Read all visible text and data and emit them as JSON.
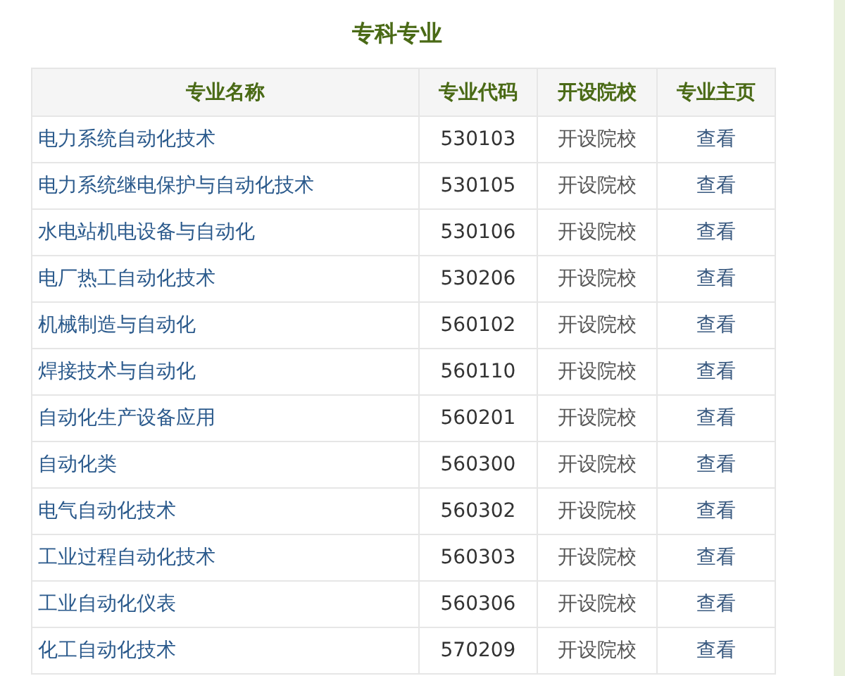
{
  "title": "专科专业",
  "table": {
    "columns": [
      "专业名称",
      "专业代码",
      "开设院校",
      "专业主页"
    ],
    "rows": [
      {
        "name": "电力系统自动化技术",
        "code": "530103",
        "schools": "开设院校",
        "homepage": "查看"
      },
      {
        "name": "电力系统继电保护与自动化技术",
        "code": "530105",
        "schools": "开设院校",
        "homepage": "查看"
      },
      {
        "name": "水电站机电设备与自动化",
        "code": "530106",
        "schools": "开设院校",
        "homepage": "查看"
      },
      {
        "name": "电厂热工自动化技术",
        "code": "530206",
        "schools": "开设院校",
        "homepage": "查看"
      },
      {
        "name": "机械制造与自动化",
        "code": "560102",
        "schools": "开设院校",
        "homepage": "查看"
      },
      {
        "name": "焊接技术与自动化",
        "code": "560110",
        "schools": "开设院校",
        "homepage": "查看"
      },
      {
        "name": "自动化生产设备应用",
        "code": "560201",
        "schools": "开设院校",
        "homepage": "查看"
      },
      {
        "name": "自动化类",
        "code": "560300",
        "schools": "开设院校",
        "homepage": "查看"
      },
      {
        "name": "电气自动化技术",
        "code": "560302",
        "schools": "开设院校",
        "homepage": "查看"
      },
      {
        "name": "工业过程自动化技术",
        "code": "560303",
        "schools": "开设院校",
        "homepage": "查看"
      },
      {
        "name": "工业自动化仪表",
        "code": "560306",
        "schools": "开设院校",
        "homepage": "查看"
      },
      {
        "name": "化工自动化技术",
        "code": "570209",
        "schools": "开设院校",
        "homepage": "查看"
      }
    ]
  }
}
